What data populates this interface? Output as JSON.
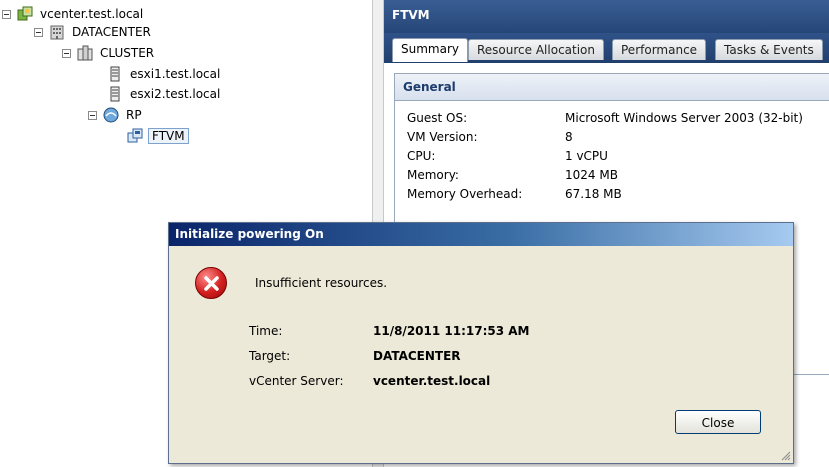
{
  "tree": {
    "items": [
      {
        "label": "vcenter.test.local",
        "icon": "vcenter-icon"
      },
      {
        "label": "DATACENTER",
        "icon": "datacenter-icon"
      },
      {
        "label": "CLUSTER",
        "icon": "cluster-icon"
      },
      {
        "label": "esxi1.test.local",
        "icon": "host-icon"
      },
      {
        "label": "esxi2.test.local",
        "icon": "host-icon"
      },
      {
        "label": "RP",
        "icon": "resource-pool-icon"
      },
      {
        "label": "FTVM",
        "icon": "vm-icon",
        "selected": true
      }
    ]
  },
  "details": {
    "title": "FTVM",
    "tabs": [
      "Summary",
      "Resource Allocation",
      "Performance",
      "Tasks & Events"
    ],
    "active_tab": "Summary",
    "general": {
      "title": "General",
      "rows": [
        {
          "key": "Guest OS:",
          "value": "Microsoft Windows Server 2003 (32-bit)"
        },
        {
          "key": "VM Version:",
          "value": "8"
        },
        {
          "key": "CPU:",
          "value": "1 vCPU"
        },
        {
          "key": "Memory:",
          "value": "1024 MB"
        },
        {
          "key": "Memory Overhead:",
          "value": "67.18 MB"
        }
      ]
    }
  },
  "dialog": {
    "title": "Initialize powering On",
    "message": "Insufficient resources.",
    "icon": "error-icon",
    "rows": [
      {
        "key": "Time:",
        "value": "11/8/2011 11:17:53 AM"
      },
      {
        "key": "Target:",
        "value": "DATACENTER"
      },
      {
        "key": "vCenter Server:",
        "value": "vcenter.test.local"
      }
    ],
    "close_label": "Close"
  },
  "colors": {
    "header_blue": "#254677",
    "dialog_title_start": "#0a246a",
    "dialog_title_end": "#a6caf0",
    "dialog_body": "#ece9d8",
    "error_red": "#d21f1f"
  }
}
